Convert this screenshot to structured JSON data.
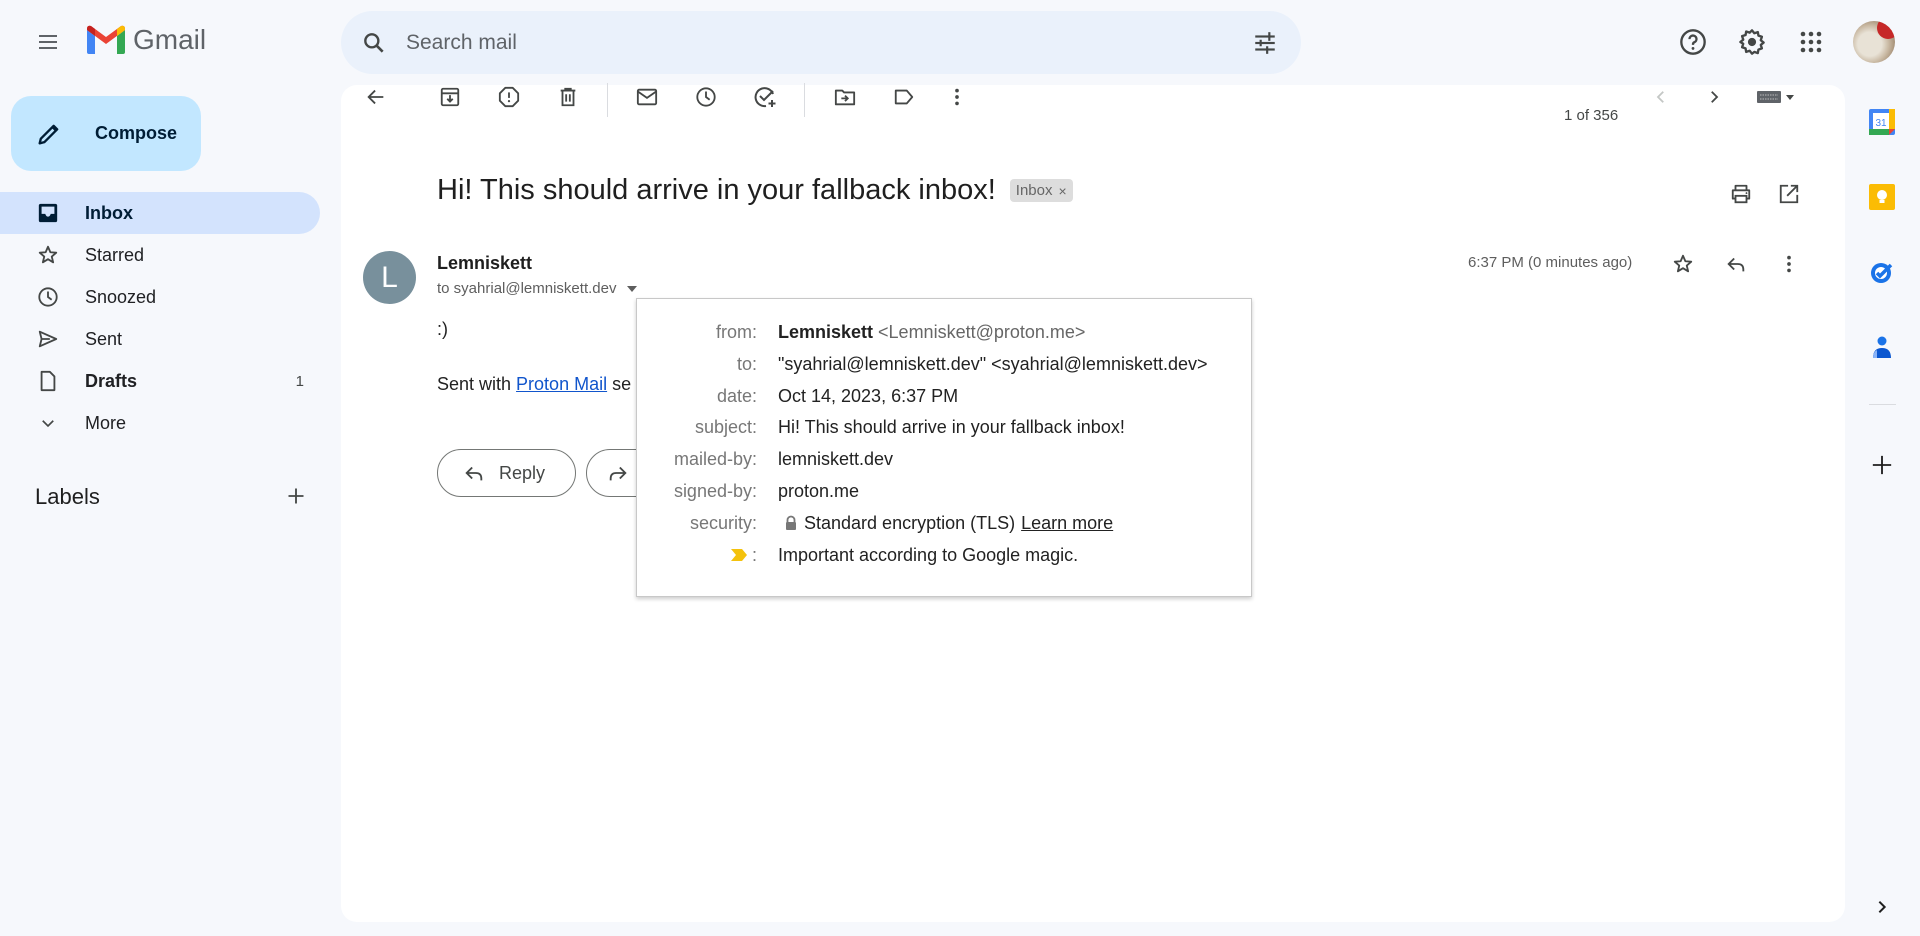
{
  "header": {
    "app_name": "Gmail",
    "search_placeholder": "Search mail",
    "icons": [
      "menu-icon",
      "search-icon",
      "search-options-icon",
      "help-icon",
      "settings-icon",
      "apps-grid-icon",
      "account-avatar"
    ]
  },
  "sidebar": {
    "compose_label": "Compose",
    "items": [
      {
        "label": "Inbox",
        "icon": "inbox-icon",
        "count": "",
        "active": true
      },
      {
        "label": "Starred",
        "icon": "star-icon",
        "count": ""
      },
      {
        "label": "Snoozed",
        "icon": "clock-icon",
        "count": ""
      },
      {
        "label": "Sent",
        "icon": "send-icon",
        "count": ""
      },
      {
        "label": "Drafts",
        "icon": "draft-icon",
        "count": "1"
      },
      {
        "label": "More",
        "icon": "chevron-down-icon",
        "count": ""
      }
    ],
    "labels_title": "Labels"
  },
  "toolbar": {
    "pager": "1 of 356",
    "actions": [
      "back",
      "archive",
      "report-spam",
      "delete",
      "mark-unread",
      "snooze",
      "add-to-tasks",
      "move-to",
      "labels",
      "more"
    ]
  },
  "message": {
    "subject": "Hi! This should arrive in your fallback inbox!",
    "label_chip": "Inbox",
    "label_chip_remove": "×",
    "sender_initial": "L",
    "sender_name": "Lemniskett",
    "to_line": "to syahrial@lemniskett.dev",
    "time": "6:37 PM (0 minutes ago)",
    "body_line1": ":)",
    "body_sent_prefix": "Sent with ",
    "body_link": "Proton Mail",
    "body_sent_suffix": " se",
    "reply_label": "Reply",
    "forward_label": "Forward"
  },
  "details_popup": {
    "from_key": "from:",
    "from_name": "Lemniskett",
    "from_email": "<Lemniskett@proton.me>",
    "to_key": "to:",
    "to_value": "\"syahrial@lemniskett.dev\" <syahrial@lemniskett.dev>",
    "date_key": "date:",
    "date_value": "Oct 14, 2023, 6:37 PM",
    "subject_key": "subject:",
    "subject_value": "Hi! This should arrive in your fallback inbox!",
    "mailed_by_key": "mailed-by:",
    "mailed_by_value": "lemniskett.dev",
    "signed_by_key": "signed-by:",
    "signed_by_value": "proton.me",
    "security_key": "security:",
    "security_value": "Standard encryption (TLS)",
    "security_link": "Learn more",
    "importance_key": ":",
    "importance_value": "Important according to Google magic."
  },
  "side_panel": {
    "apps": [
      "Calendar",
      "Keep",
      "Tasks",
      "Contacts"
    ],
    "calendar_day": "31"
  },
  "colors": {
    "accent": "#0b57d0",
    "compose_bg": "#c2e7ff",
    "active_nav_bg": "#d3e3fd",
    "avatar_bg": "#78909c",
    "important_marker": "#f4c20d"
  }
}
